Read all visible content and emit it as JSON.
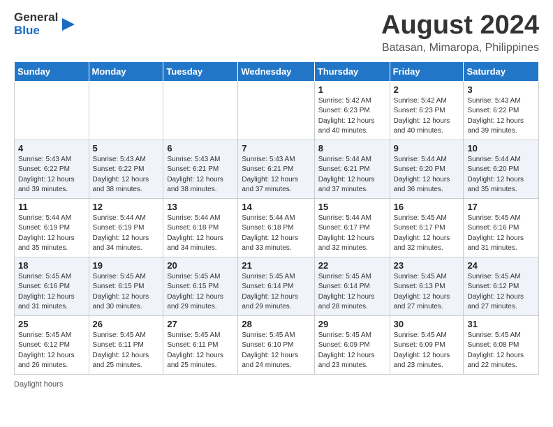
{
  "header": {
    "logo_general": "General",
    "logo_blue": "Blue",
    "title": "August 2024",
    "subtitle": "Batasan, Mimaropa, Philippines"
  },
  "columns": [
    "Sunday",
    "Monday",
    "Tuesday",
    "Wednesday",
    "Thursday",
    "Friday",
    "Saturday"
  ],
  "weeks": [
    [
      {
        "day": "",
        "detail": ""
      },
      {
        "day": "",
        "detail": ""
      },
      {
        "day": "",
        "detail": ""
      },
      {
        "day": "",
        "detail": ""
      },
      {
        "day": "1",
        "detail": "Sunrise: 5:42 AM\nSunset: 6:23 PM\nDaylight: 12 hours\nand 40 minutes."
      },
      {
        "day": "2",
        "detail": "Sunrise: 5:42 AM\nSunset: 6:23 PM\nDaylight: 12 hours\nand 40 minutes."
      },
      {
        "day": "3",
        "detail": "Sunrise: 5:43 AM\nSunset: 6:22 PM\nDaylight: 12 hours\nand 39 minutes."
      }
    ],
    [
      {
        "day": "4",
        "detail": "Sunrise: 5:43 AM\nSunset: 6:22 PM\nDaylight: 12 hours\nand 39 minutes."
      },
      {
        "day": "5",
        "detail": "Sunrise: 5:43 AM\nSunset: 6:22 PM\nDaylight: 12 hours\nand 38 minutes."
      },
      {
        "day": "6",
        "detail": "Sunrise: 5:43 AM\nSunset: 6:21 PM\nDaylight: 12 hours\nand 38 minutes."
      },
      {
        "day": "7",
        "detail": "Sunrise: 5:43 AM\nSunset: 6:21 PM\nDaylight: 12 hours\nand 37 minutes."
      },
      {
        "day": "8",
        "detail": "Sunrise: 5:44 AM\nSunset: 6:21 PM\nDaylight: 12 hours\nand 37 minutes."
      },
      {
        "day": "9",
        "detail": "Sunrise: 5:44 AM\nSunset: 6:20 PM\nDaylight: 12 hours\nand 36 minutes."
      },
      {
        "day": "10",
        "detail": "Sunrise: 5:44 AM\nSunset: 6:20 PM\nDaylight: 12 hours\nand 35 minutes."
      }
    ],
    [
      {
        "day": "11",
        "detail": "Sunrise: 5:44 AM\nSunset: 6:19 PM\nDaylight: 12 hours\nand 35 minutes."
      },
      {
        "day": "12",
        "detail": "Sunrise: 5:44 AM\nSunset: 6:19 PM\nDaylight: 12 hours\nand 34 minutes."
      },
      {
        "day": "13",
        "detail": "Sunrise: 5:44 AM\nSunset: 6:18 PM\nDaylight: 12 hours\nand 34 minutes."
      },
      {
        "day": "14",
        "detail": "Sunrise: 5:44 AM\nSunset: 6:18 PM\nDaylight: 12 hours\nand 33 minutes."
      },
      {
        "day": "15",
        "detail": "Sunrise: 5:44 AM\nSunset: 6:17 PM\nDaylight: 12 hours\nand 32 minutes."
      },
      {
        "day": "16",
        "detail": "Sunrise: 5:45 AM\nSunset: 6:17 PM\nDaylight: 12 hours\nand 32 minutes."
      },
      {
        "day": "17",
        "detail": "Sunrise: 5:45 AM\nSunset: 6:16 PM\nDaylight: 12 hours\nand 31 minutes."
      }
    ],
    [
      {
        "day": "18",
        "detail": "Sunrise: 5:45 AM\nSunset: 6:16 PM\nDaylight: 12 hours\nand 31 minutes."
      },
      {
        "day": "19",
        "detail": "Sunrise: 5:45 AM\nSunset: 6:15 PM\nDaylight: 12 hours\nand 30 minutes."
      },
      {
        "day": "20",
        "detail": "Sunrise: 5:45 AM\nSunset: 6:15 PM\nDaylight: 12 hours\nand 29 minutes."
      },
      {
        "day": "21",
        "detail": "Sunrise: 5:45 AM\nSunset: 6:14 PM\nDaylight: 12 hours\nand 29 minutes."
      },
      {
        "day": "22",
        "detail": "Sunrise: 5:45 AM\nSunset: 6:14 PM\nDaylight: 12 hours\nand 28 minutes."
      },
      {
        "day": "23",
        "detail": "Sunrise: 5:45 AM\nSunset: 6:13 PM\nDaylight: 12 hours\nand 27 minutes."
      },
      {
        "day": "24",
        "detail": "Sunrise: 5:45 AM\nSunset: 6:12 PM\nDaylight: 12 hours\nand 27 minutes."
      }
    ],
    [
      {
        "day": "25",
        "detail": "Sunrise: 5:45 AM\nSunset: 6:12 PM\nDaylight: 12 hours\nand 26 minutes."
      },
      {
        "day": "26",
        "detail": "Sunrise: 5:45 AM\nSunset: 6:11 PM\nDaylight: 12 hours\nand 25 minutes."
      },
      {
        "day": "27",
        "detail": "Sunrise: 5:45 AM\nSunset: 6:11 PM\nDaylight: 12 hours\nand 25 minutes."
      },
      {
        "day": "28",
        "detail": "Sunrise: 5:45 AM\nSunset: 6:10 PM\nDaylight: 12 hours\nand 24 minutes."
      },
      {
        "day": "29",
        "detail": "Sunrise: 5:45 AM\nSunset: 6:09 PM\nDaylight: 12 hours\nand 23 minutes."
      },
      {
        "day": "30",
        "detail": "Sunrise: 5:45 AM\nSunset: 6:09 PM\nDaylight: 12 hours\nand 23 minutes."
      },
      {
        "day": "31",
        "detail": "Sunrise: 5:45 AM\nSunset: 6:08 PM\nDaylight: 12 hours\nand 22 minutes."
      }
    ]
  ],
  "footer": {
    "note": "Daylight hours"
  }
}
